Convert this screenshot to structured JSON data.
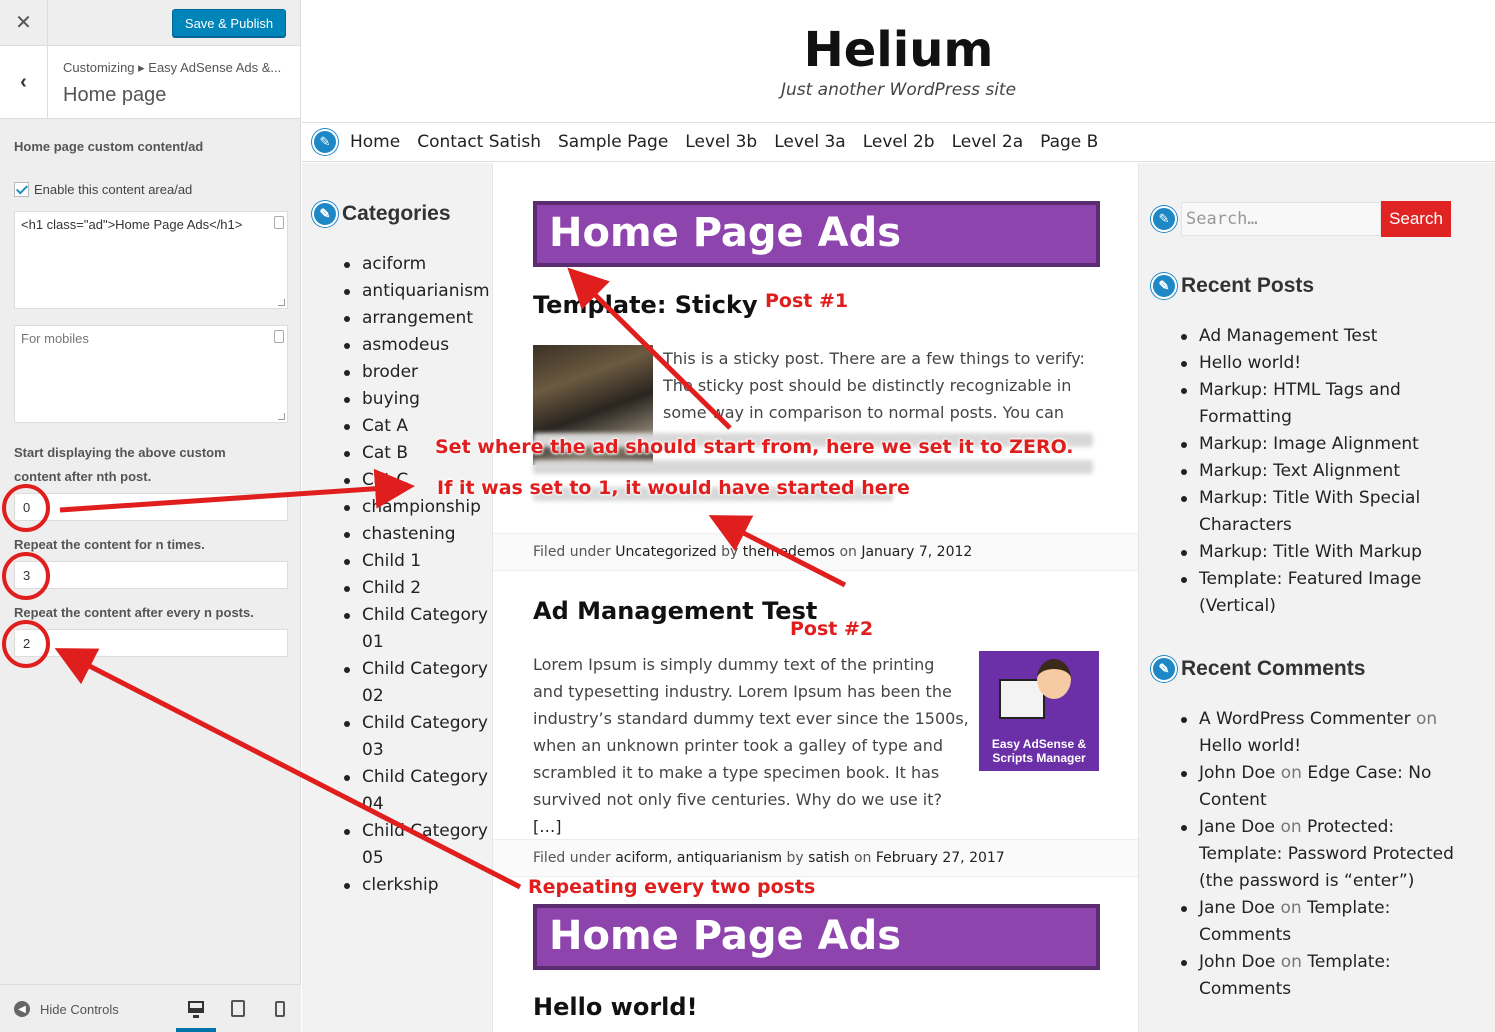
{
  "customizer": {
    "close_icon": "close-icon",
    "publish_label": "Save & Publish",
    "back_icon": "chevron-left-icon",
    "breadcrumb": "Customizing ▸ Easy AdSense Ads &...",
    "section_title": "Home page",
    "field_heading": "Home page custom content/ad",
    "enable_label": "Enable this content area/ad",
    "enable_checked": true,
    "content_value": "<h1 class=\"ad\">Home Page Ads</h1>",
    "mobile_placeholder": "For mobiles",
    "start_label_1": "Start displaying the above custom",
    "start_label_2": "content after nth post.",
    "start_value": "0",
    "repeat_times_label": "Repeat the content for n times.",
    "repeat_times_value": "3",
    "repeat_every_label": "Repeat the content after every n posts.",
    "repeat_every_value": "2",
    "hide_controls_label": "Hide Controls",
    "devices": [
      "desktop-icon",
      "tablet-icon",
      "mobile-icon"
    ],
    "accent_color": "#0085ba"
  },
  "site": {
    "title": "Helium",
    "tagline": "Just another WordPress site",
    "nav": [
      "Home",
      "Contact Satish",
      "Sample Page",
      "Level 3b",
      "Level 3a",
      "Level 2b",
      "Level 2a",
      "Page B"
    ],
    "categories_heading": "Categories",
    "categories": [
      "aciform",
      "antiquarianism",
      "arrangement",
      "asmodeus",
      "broder",
      "buying",
      "Cat A",
      "Cat B",
      "Cat C",
      "championship",
      "chastening",
      "Child 1",
      "Child 2",
      "Child Category 01",
      "Child Category 02",
      "Child Category 03",
      "Child Category 04",
      "Child Category 05",
      "clerkship"
    ],
    "ad_text": "Home Page Ads",
    "ad_color": "#8e44ad",
    "post1": {
      "title": "Template: Sticky",
      "text": "This is a sticky post. There are a few things to verify: The sticky post should be distinctly recognizable in some way in comparison to normal posts. You can",
      "filed_prefix": "Filed under",
      "filed_cat": "Uncategorized",
      "filed_by": "by",
      "filed_author": "themedemos",
      "filed_on": "on",
      "filed_date": "January 7, 2012"
    },
    "post2": {
      "title": "Ad Management Test",
      "text": "Lorem Ipsum is simply dummy text of the printing and typesetting industry. Lorem Ipsum has been the industry’s standard dummy text ever since the 1500s, when an unknown printer took a galley of type and scrambled it to make a type specimen book. It has survived not only five centuries. Why do we use it?",
      "more": "[…]",
      "thumb_text": "Easy AdSense & Scripts Manager",
      "filed_prefix": "Filed under",
      "filed_cat": "aciform, antiquarianism",
      "filed_by": "by",
      "filed_author": "satish",
      "filed_on": "on",
      "filed_date": "February 27, 2017"
    },
    "post3": {
      "title": "Hello world!"
    },
    "search_placeholder": "Search…",
    "search_button": "Search",
    "search_button_color": "#e02424",
    "recent_posts_heading": "Recent Posts",
    "recent_posts": [
      "Ad Management Test",
      "Hello world!",
      "Markup: HTML Tags and Formatting",
      "Markup: Image Alignment",
      "Markup: Text Alignment",
      "Markup: Title With Special Characters",
      "Markup: Title With Markup",
      "Template: Featured Image (Vertical)"
    ],
    "recent_comments_heading": "Recent Comments",
    "recent_comments": [
      {
        "author": "A WordPress Commenter",
        "on": "on",
        "post": "Hello world!"
      },
      {
        "author": "John Doe",
        "on": "on",
        "post": "Edge Case: No Content"
      },
      {
        "author": "Jane Doe",
        "on": "on",
        "post": "Protected: Template: Password Protected (the password is “enter”)"
      },
      {
        "author": "Jane Doe",
        "on": "on",
        "post": "Template: Comments"
      },
      {
        "author": "John Doe",
        "on": "on",
        "post": "Template: Comments"
      }
    ]
  },
  "annotations": {
    "post1": "Post #1",
    "post2": "Post #2",
    "start_zero": "Set where the ad should start from, here we set it to ZERO.",
    "start_one": "If it was set to 1, it would have started here",
    "repeating": "Repeating every two posts",
    "color": "#e01e1e"
  }
}
